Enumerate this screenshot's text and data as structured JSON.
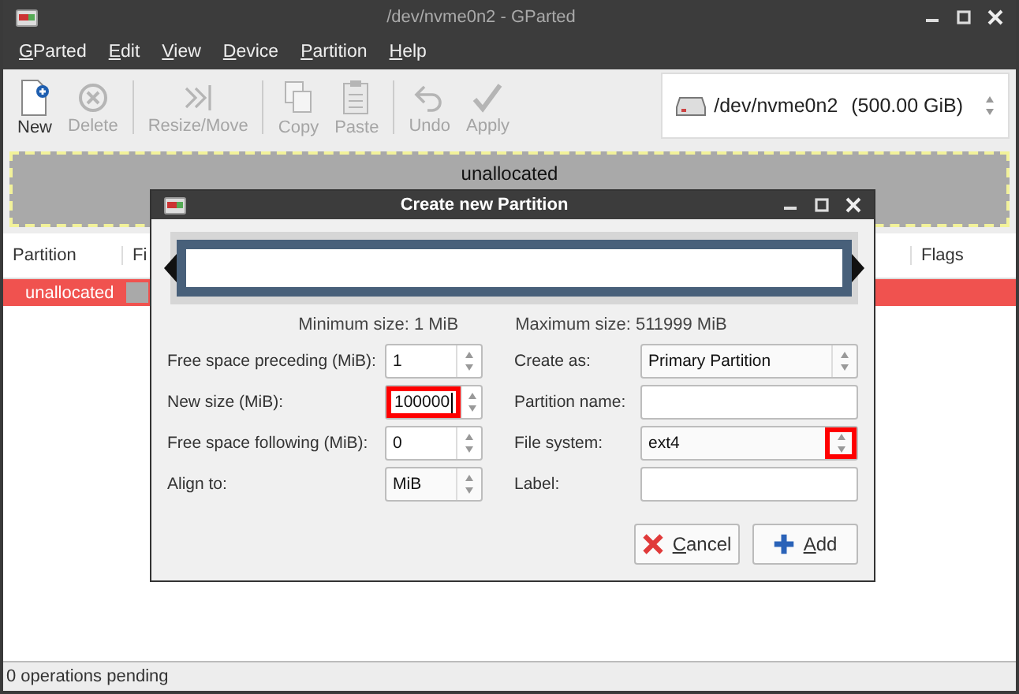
{
  "window": {
    "title": "/dev/nvme0n2 - GParted"
  },
  "menu": [
    {
      "label": "GParted",
      "mnemonic_underlined": true
    },
    {
      "label": "Edit",
      "mnemonic_underlined": true
    },
    {
      "label": "View",
      "mnemonic_underlined": true
    },
    {
      "label": "Device",
      "mnemonic_underlined": true
    },
    {
      "label": "Partition",
      "mnemonic_underlined": true
    },
    {
      "label": "Help",
      "mnemonic_underlined": true
    }
  ],
  "toolbar": {
    "groups": [
      [
        {
          "label": "New",
          "disabled": false
        },
        {
          "label": "Delete",
          "disabled": true
        }
      ],
      [
        {
          "label": "Resize/Move",
          "disabled": true
        }
      ],
      [
        {
          "label": "Copy",
          "disabled": true
        },
        {
          "label": "Paste",
          "disabled": true
        }
      ],
      [
        {
          "label": "Undo",
          "disabled": true
        },
        {
          "label": "Apply",
          "disabled": true
        }
      ]
    ]
  },
  "device": {
    "name": "/dev/nvme0n2",
    "size": "(500.00 GiB)"
  },
  "disk_map": {
    "label": "unallocated"
  },
  "table": {
    "columns": [
      "Partition",
      "Fi",
      "Flags"
    ],
    "rows": [
      {
        "partition": "unallocated",
        "selected": true
      }
    ]
  },
  "status_bar": "0 operations pending",
  "dialog": {
    "title": "Create new Partition",
    "min_size": "Minimum size: 1 MiB",
    "max_size": "Maximum size: 511999 MiB",
    "left_fields": [
      {
        "label": "Free space preceding (MiB):",
        "value": "1",
        "kind": "spin",
        "highlighted": false,
        "focused": false
      },
      {
        "label": "New size (MiB):",
        "value": "100000",
        "kind": "spin",
        "highlighted": true,
        "focused": true
      },
      {
        "label": "Free space following (MiB):",
        "value": "0",
        "kind": "spin",
        "highlighted": false,
        "focused": false
      },
      {
        "label": "Align to:",
        "value": "MiB",
        "kind": "combo",
        "highlighted": false
      }
    ],
    "right_fields": [
      {
        "label": "Create as:",
        "value": "Primary Partition",
        "kind": "combo",
        "highlighted": false
      },
      {
        "label": "Partition name:",
        "kind": "text"
      },
      {
        "label": "File system:",
        "value": "ext4",
        "kind": "combo",
        "highlighted": true
      },
      {
        "label": "Label:",
        "kind": "text"
      }
    ],
    "buttons": [
      {
        "label": "Cancel",
        "mnemonic_underlined": true,
        "kind": "cancel"
      },
      {
        "label": "Add",
        "mnemonic_underlined": true,
        "kind": "add"
      }
    ]
  }
}
